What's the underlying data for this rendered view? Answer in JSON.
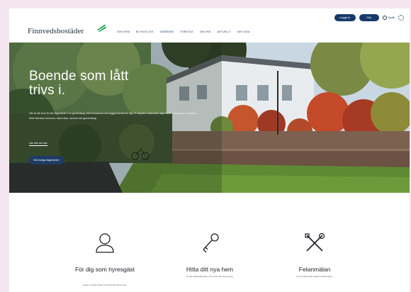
{
  "header": {
    "logo_text": "Finnvedsbostäder",
    "nav": [
      "SÖK HEM",
      "BO HOS OSS",
      "OMRÅDEN",
      "FÖRETAG",
      "OM OSS",
      "AKTUELLT",
      "MIN SIDA"
    ],
    "login_label": "Logga in",
    "search_label": "Sök",
    "lang_label": "Språk"
  },
  "hero": {
    "title": "Boende som lått trivs i.",
    "text": "Här är ditt hem för fler lägenheter i en gemenskap med trivsamma och tryggt boende för dig. Vi erbjuder varierande lägenheter i trivsamma områden i hela Värnamo kommun, nära natur, service och gemenskap.",
    "link_label": "Läs mer om oss",
    "button_label": "Sök lediga lägenheter"
  },
  "cards": [
    {
      "icon": "person-icon",
      "title": "För dig som hyresgäst",
      "desc": "Logga in på Mina Sidor för att hantera ditt boende."
    },
    {
      "icon": "key-icon",
      "title": "Hitta ditt nya hem",
      "desc": "Se alla lediga lägenheter och anmäl ditt intresse idag."
    },
    {
      "icon": "tools-icon",
      "title": "Felanmälan",
      "desc": "Gör din felanmälan digitalt via Mina Sidor."
    }
  ],
  "colors": {
    "brand": "#173a6b",
    "accent": "#1a9f4a",
    "page_bg": "#f4e6ef"
  }
}
